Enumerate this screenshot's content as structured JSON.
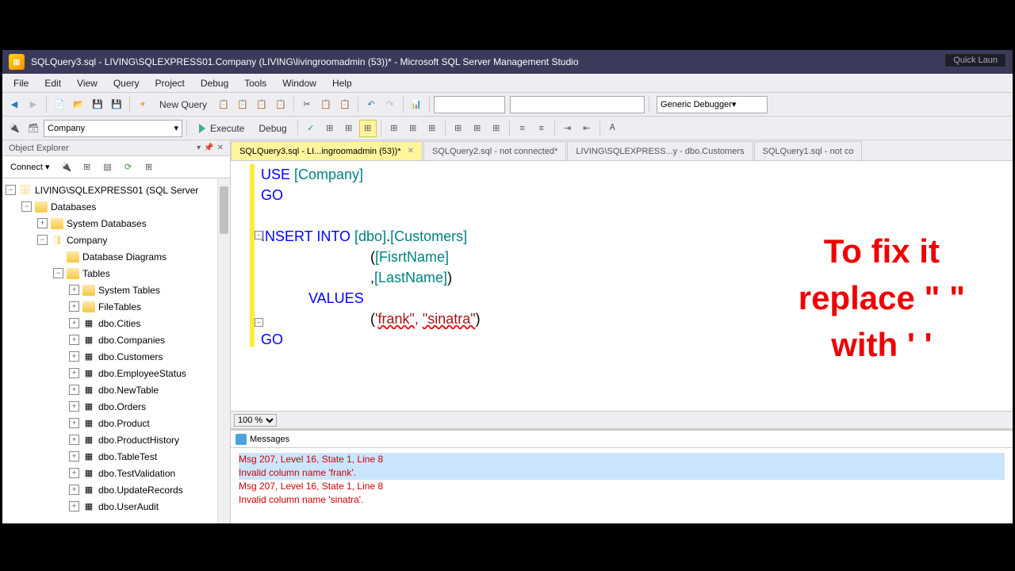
{
  "title": "SQLQuery3.sql - LIVING\\SQLEXPRESS01.Company (LIVING\\livingroomadmin (53))* - Microsoft SQL Server Management Studio",
  "quick_launch": "Quick Laun",
  "menu": [
    "File",
    "Edit",
    "View",
    "Query",
    "Project",
    "Debug",
    "Tools",
    "Window",
    "Help"
  ],
  "toolbar1": {
    "new_query": "New Query",
    "debugger": "Generic Debugger"
  },
  "toolbar2": {
    "database": "Company",
    "execute": "Execute",
    "debug": "Debug"
  },
  "object_explorer": {
    "title": "Object Explorer",
    "connect": "Connect",
    "server": "LIVING\\SQLEXPRESS01 (SQL Server",
    "databases": "Databases",
    "sys_db": "System Databases",
    "company": "Company",
    "diagrams": "Database Diagrams",
    "tables_label": "Tables",
    "sys_tables": "System Tables",
    "file_tables": "FileTables",
    "tables": [
      "dbo.Cities",
      "dbo.Companies",
      "dbo.Customers",
      "dbo.EmployeeStatus",
      "dbo.NewTable",
      "dbo.Orders",
      "dbo.Product",
      "dbo.ProductHistory",
      "dbo.TableTest",
      "dbo.TestValidation",
      "dbo.UpdateRecords",
      "dbo.UserAudit"
    ]
  },
  "tabs": [
    {
      "label": "SQLQuery3.sql - LI...ingroomadmin (53))*",
      "active": true
    },
    {
      "label": "SQLQuery2.sql - not connected*",
      "active": false
    },
    {
      "label": "LIVING\\SQLEXPRESS...y - dbo.Customers",
      "active": false
    },
    {
      "label": "SQLQuery1.sql - not co",
      "active": false
    }
  ],
  "code": {
    "l1a": "USE ",
    "l1b": "[Company]",
    "l2": "GO",
    "l3a": "INSERT ",
    "l3b": "INTO ",
    "l3c": "[dbo]",
    "l3d": ".",
    "l3e": "[Customers]",
    "l4a": "(",
    "l4b": "[FisrtName]",
    "l5a": ",",
    "l5b": "[LastName]",
    "l5c": ")",
    "l6": "VALUES",
    "l7a": "(",
    "l7b": "'",
    "l7c": "frank\"",
    "l7d": ", ",
    "l7e": "\"sinatra\"",
    "l7f": ")",
    "l8": "GO"
  },
  "zoom": "100 %",
  "annotation": {
    "l1": "To fix it",
    "l2": "replace \" \"",
    "l3": "with ' '"
  },
  "messages": {
    "tab": "Messages",
    "lines": [
      "Msg 207, Level 16, State 1, Line 8",
      "Invalid column name 'frank'.",
      "Msg 207, Level 16, State 1, Line 8",
      "Invalid column name 'sinatra'."
    ]
  }
}
